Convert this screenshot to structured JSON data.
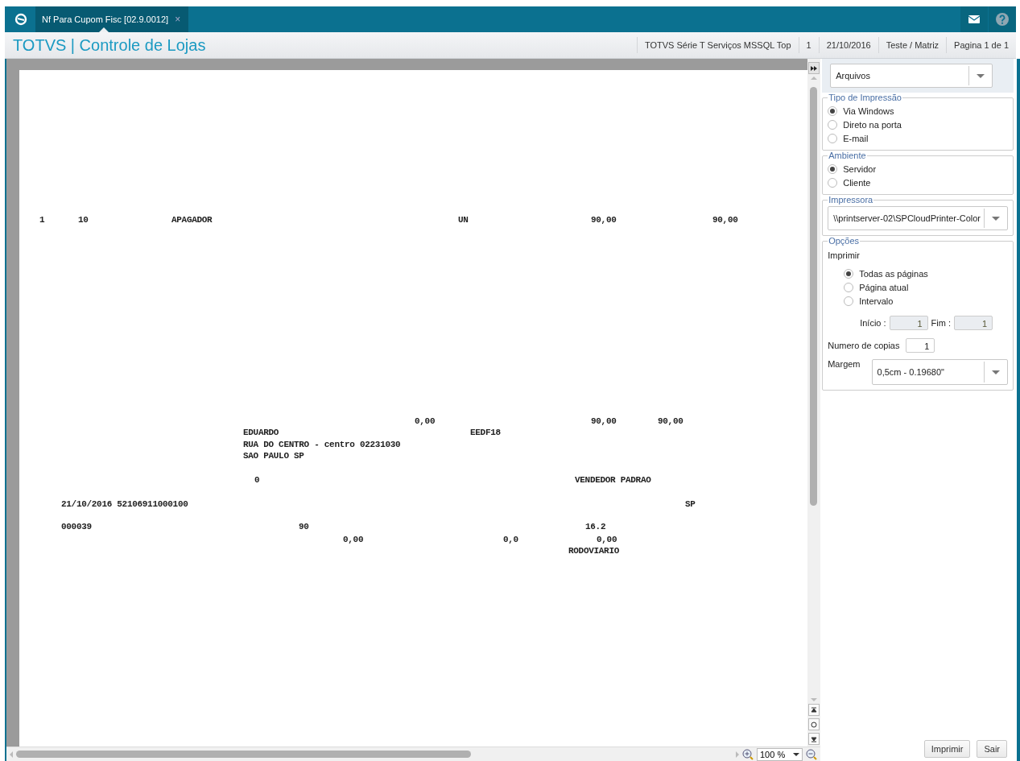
{
  "app": {
    "tab": {
      "title": "Nf Para Cupom Fisc [02.9.0012]",
      "close": "×",
      "selected": true
    }
  },
  "header": {
    "title": "TOTVS | Controle de Lojas",
    "info": [
      "TOTVS Série T Serviços MSSQL Top",
      "1",
      "21/10/2016",
      "Teste / Matriz",
      "Pagina 1 de 1"
    ]
  },
  "report": {
    "texts": [
      "1",
      "10",
      "APAGADOR",
      "UN",
      "90,00",
      "90,00",
      "0,00",
      "90,00",
      "90,00",
      "EDUARDO",
      "EEDF18",
      "RUA DO CENTRO - centro 02231030",
      "SAO PAULO SP",
      "0",
      "VENDEDOR PADRAO",
      "21/10/2016 52106911000100",
      "SP",
      "000039",
      "90",
      "16.2",
      "0,00",
      "0,0",
      "0,00",
      "RODOVIARIO"
    ]
  },
  "preview": {
    "zoom": "100 %"
  },
  "panel": {
    "output": "Arquivos",
    "print_type": {
      "legend": "Tipo de Impressão",
      "options": [
        {
          "label": "Via Windows",
          "selected": true
        },
        {
          "label": "Direto na porta",
          "selected": false
        },
        {
          "label": "E-mail",
          "selected": false
        }
      ]
    },
    "environment": {
      "legend": "Ambiente",
      "options": [
        {
          "label": "Servidor",
          "selected": true
        },
        {
          "label": "Cliente",
          "selected": false
        }
      ]
    },
    "printer": {
      "legend": "Impressora",
      "value": "\\\\printserver-02\\SPCloudPrinter-Color"
    },
    "options": {
      "legend": "Opções",
      "print_label": "Imprimir",
      "pages": [
        {
          "label": "Todas as páginas",
          "selected": true
        },
        {
          "label": "Página atual",
          "selected": false
        },
        {
          "label": "Intervalo",
          "selected": false
        }
      ],
      "start_label": "Início :",
      "start": "1",
      "end_label": "Fim :",
      "end": "1",
      "copies_label": "Numero de copias",
      "copies": "1",
      "margin_label": "Margem",
      "margin": "0,5cm - 0.19680\""
    }
  },
  "buttons": [
    "Imprimir",
    "Sair"
  ]
}
